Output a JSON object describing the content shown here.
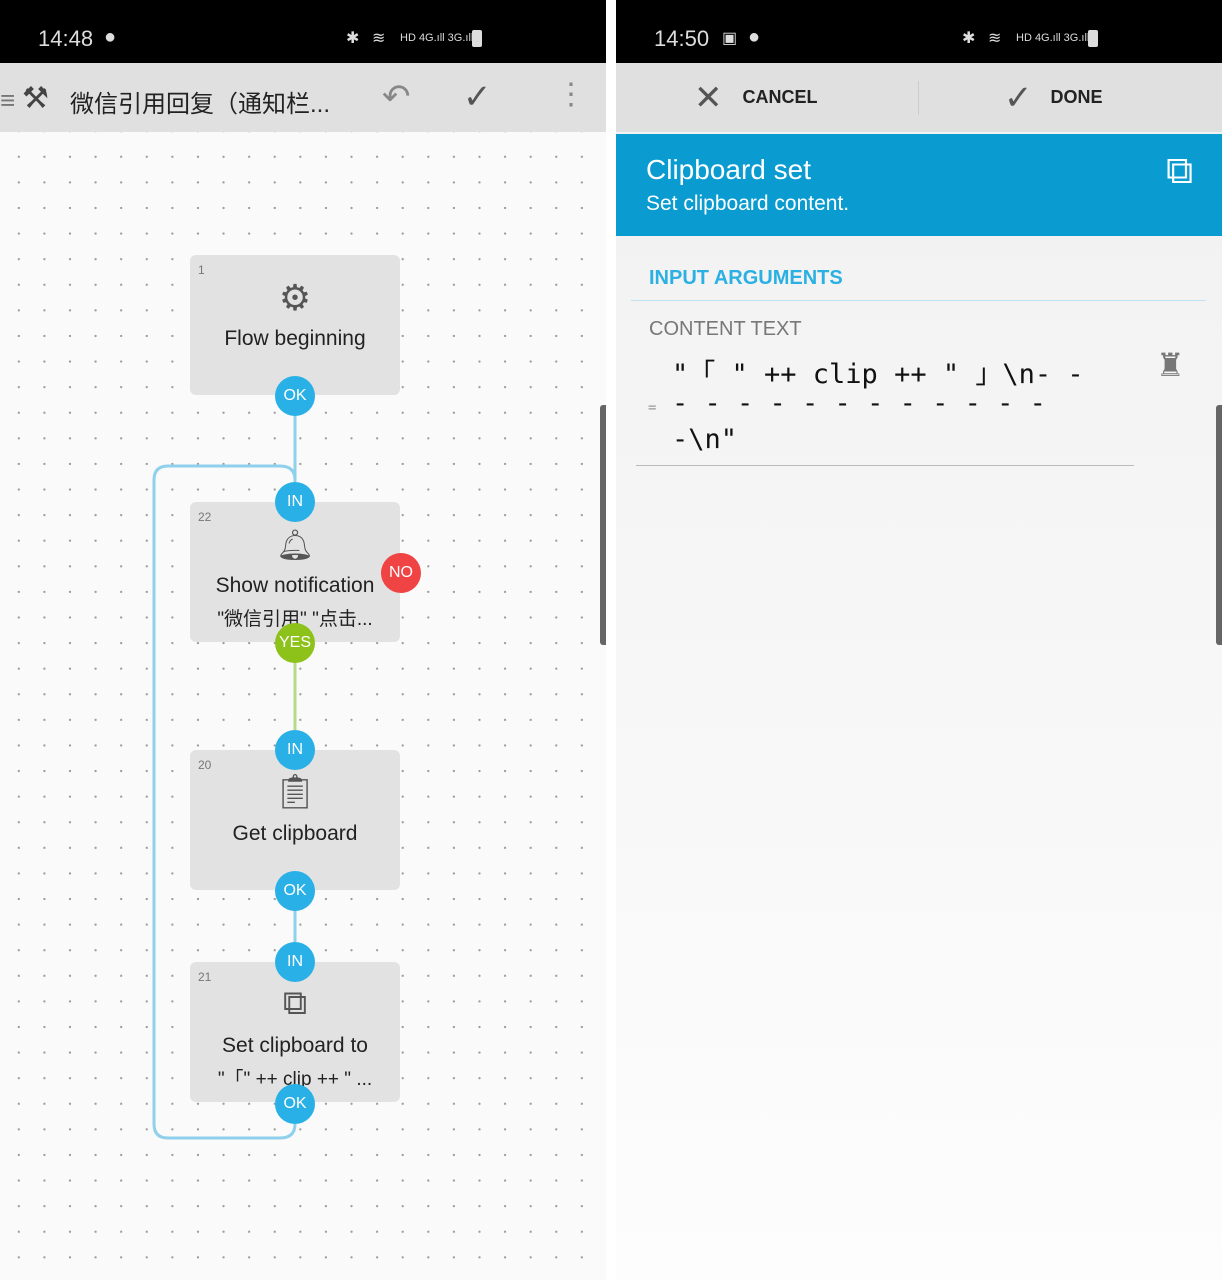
{
  "left": {
    "status": {
      "time": "14:48",
      "icons": [
        "spotify-icon",
        "bluetooth-icon",
        "wifi-icon",
        "HD",
        "4G",
        "3G",
        "battery-icon"
      ]
    },
    "toolbar": {
      "title": "微信引用回复（通知栏...",
      "icons": [
        "menu-icon",
        "tools-icon",
        "undo-icon",
        "check-icon",
        "more-vert-icon"
      ]
    },
    "nodes": [
      {
        "num": "1",
        "icon": "gear-icon",
        "title": "Flow beginning",
        "subtitle": ""
      },
      {
        "num": "22",
        "icon": "bell-icon",
        "title": "Show notification",
        "subtitle": "\"微信引用\" \"点击..."
      },
      {
        "num": "20",
        "icon": "clipboard-icon",
        "title": "Get clipboard",
        "subtitle": ""
      },
      {
        "num": "21",
        "icon": "copy-icon",
        "title": "Set clipboard to",
        "subtitle": "\"「\" ++ clip ++ \" ..."
      }
    ],
    "ports": {
      "ok": "OK",
      "in": "IN",
      "no": "NO",
      "yes": "YES"
    },
    "colors": {
      "port": "#29b0e6",
      "no": "#f04343",
      "yes": "#8cc21a",
      "line": "#8fd0ec"
    }
  },
  "right": {
    "status": {
      "time": "14:50"
    },
    "toolbar": {
      "cancel": "CANCEL",
      "done": "DONE"
    },
    "header": {
      "title": "Clipboard set",
      "subtitle": "Set clipboard content.",
      "color": "#0a9bd0"
    },
    "section": "INPUT ARGUMENTS",
    "field": {
      "label": "CONTENT TEXT",
      "line1": "\"「 \" ++ clip ++ \" 」\\n- -",
      "line2": "- - - - - - - - - - - -",
      "line3": "-\\n\"",
      "prefix": "="
    }
  }
}
